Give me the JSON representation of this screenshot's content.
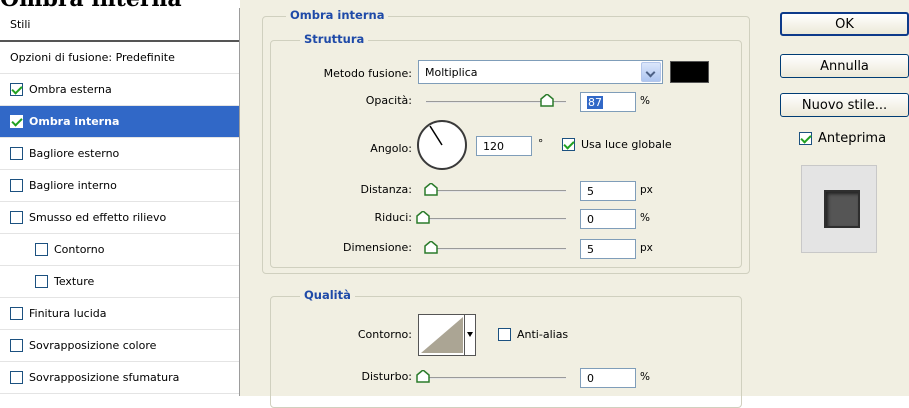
{
  "heading": "Ombra interna",
  "left_panel": {
    "header": "Stili",
    "items": [
      {
        "label": "Opzioni di fusione: Predefinite",
        "checkbox": false,
        "checked": false,
        "indent": 0,
        "selected": false
      },
      {
        "label": "Ombra esterna",
        "checkbox": true,
        "checked": true,
        "indent": 0,
        "selected": false
      },
      {
        "label": "Ombra interna",
        "checkbox": true,
        "checked": true,
        "indent": 0,
        "selected": true
      },
      {
        "label": "Bagliore esterno",
        "checkbox": true,
        "checked": false,
        "indent": 0,
        "selected": false
      },
      {
        "label": "Bagliore interno",
        "checkbox": true,
        "checked": false,
        "indent": 0,
        "selected": false
      },
      {
        "label": "Smusso ed effetto rilievo",
        "checkbox": true,
        "checked": false,
        "indent": 0,
        "selected": false
      },
      {
        "label": "Contorno",
        "checkbox": true,
        "checked": false,
        "indent": 1,
        "selected": false
      },
      {
        "label": "Texture",
        "checkbox": true,
        "checked": false,
        "indent": 1,
        "selected": false
      },
      {
        "label": "Finitura lucida",
        "checkbox": true,
        "checked": false,
        "indent": 0,
        "selected": false
      },
      {
        "label": "Sovrapposizione colore",
        "checkbox": true,
        "checked": false,
        "indent": 0,
        "selected": false
      },
      {
        "label": "Sovrapposizione sfumatura",
        "checkbox": true,
        "checked": false,
        "indent": 0,
        "selected": false
      }
    ]
  },
  "inner_shadow": {
    "group_title": "Ombra interna",
    "structure": {
      "title": "Struttura",
      "blend_mode_label": "Metodo fusione:",
      "blend_mode_value": "Moltiplica",
      "shadow_color": "#000000",
      "opacity_label": "Opacità:",
      "opacity_value": "87",
      "opacity_unit": "%",
      "opacity_fraction": 0.87,
      "angle_label": "Angolo:",
      "angle_value": "120",
      "angle_unit": "°",
      "global_light_label": "Usa luce globale",
      "global_light_checked": true,
      "distance_label": "Distanza:",
      "distance_value": "5",
      "distance_unit": "px",
      "choke_label": "Riduci:",
      "choke_value": "0",
      "choke_unit": "%",
      "size_label": "Dimensione:",
      "size_value": "5",
      "size_unit": "px"
    },
    "quality": {
      "title": "Qualità",
      "contour_label": "Contorno:",
      "anti_alias_label": "Anti-alias",
      "anti_alias_checked": false,
      "noise_label": "Disturbo:",
      "noise_value": "0",
      "noise_unit": "%"
    }
  },
  "right_panel": {
    "ok_label": "OK",
    "cancel_label": "Annulla",
    "new_style_label": "Nuovo stile...",
    "preview_label": "Anteprima",
    "preview_checked": true
  }
}
